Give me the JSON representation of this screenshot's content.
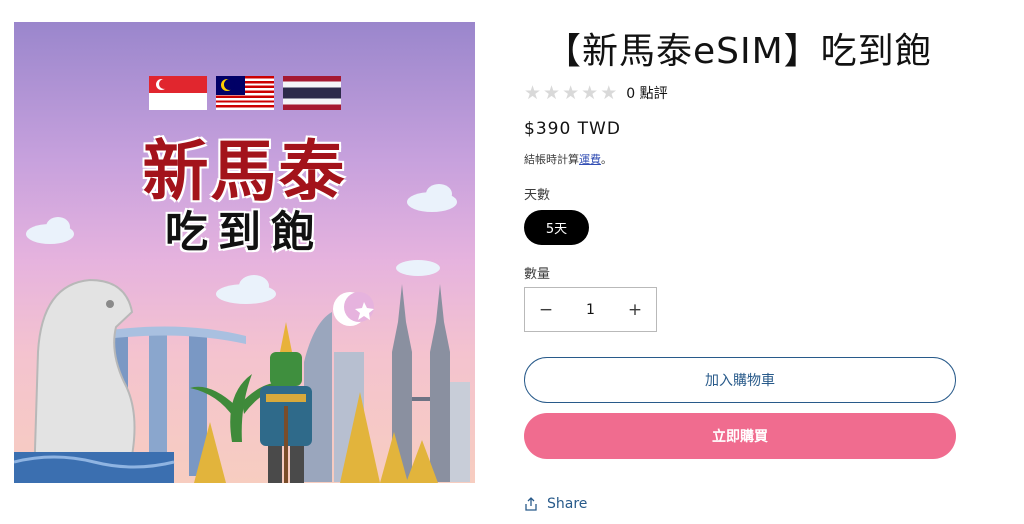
{
  "product": {
    "title": "【新馬泰eSIM】吃到飽",
    "image": {
      "headline": "新馬泰",
      "subline": "吃到飽"
    },
    "rating": {
      "stars_filled": 0,
      "stars_total": 5,
      "count_label": "0 點評"
    },
    "price": "$390 TWD",
    "tax_note": {
      "prefix": "結帳時計算",
      "link": "運費",
      "suffix": "。"
    },
    "variant": {
      "label": "天數",
      "selected": "5天"
    },
    "quantity": {
      "label": "數量",
      "value": "1",
      "decrease": "−",
      "increase": "+"
    },
    "buttons": {
      "add_to_cart": "加入購物車",
      "buy_now": "立即購買"
    },
    "share": "Share"
  },
  "colors": {
    "buy_now_bg": "#f06c8f",
    "outline_button": "#285a8a",
    "link": "#334fb4",
    "star_empty": "#d9d9d9"
  },
  "icons": [
    "star-icon",
    "minus-icon",
    "plus-icon",
    "share-icon"
  ]
}
